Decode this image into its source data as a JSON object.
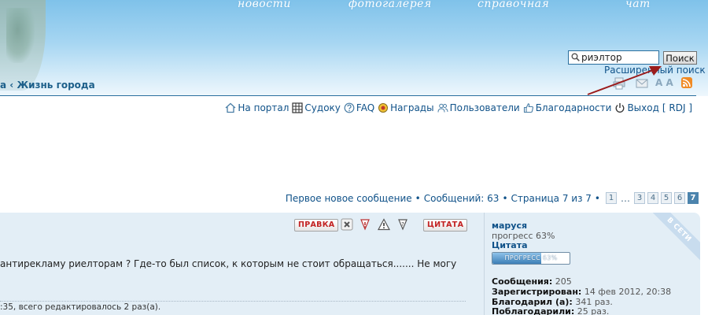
{
  "header": {
    "nav": [
      "новости",
      "фотогалерея",
      "справочная",
      "чат"
    ],
    "search": {
      "value": "риэлтор",
      "button_label": "Поиск",
      "advanced_link": "Расширенный поиск"
    },
    "breadcrumb": {
      "prev": "а",
      "separator": "‹",
      "current": "Жизнь города"
    },
    "tools": {
      "font_size": "A A"
    }
  },
  "navbar": {
    "items": [
      {
        "label": "На портал",
        "icon": "home-icon"
      },
      {
        "label": "Судоку",
        "icon": "grid-icon"
      },
      {
        "label": "FAQ",
        "icon": "help-icon"
      },
      {
        "label": "Награды",
        "icon": "medal-icon"
      },
      {
        "label": "Пользователи",
        "icon": "users-icon"
      },
      {
        "label": "Благодарности",
        "icon": "thumbs-up-icon"
      },
      {
        "label": "Выход",
        "icon": "power-icon"
      }
    ],
    "user": "[ RDJ ]"
  },
  "pagination": {
    "first_new": "Первое новое сообщение",
    "bullet": "•",
    "messages": "Сообщений: 63",
    "page_info": "Страница 7 из 7",
    "pages": [
      "1",
      "3",
      "4",
      "5",
      "6",
      "7"
    ],
    "dots": "…",
    "current": "7"
  },
  "post": {
    "buttons": {
      "edit": "ПРАВКА",
      "quote": "ЦИТАТА"
    },
    "text": "антирекламу риелторам ? Где-то был список, к которым не стоит обращаться....... Не могу",
    "edit_notice": ":35, всего редактировалось 2 раз(а).",
    "profile": {
      "username": "маруся",
      "rank": "прогресс 63%",
      "quote_link": "Цитата",
      "progress_label": "ПРОГРЕСС 63%",
      "progress_value": 0.63,
      "online": "В СЕТИ",
      "stats": [
        {
          "label": "Сообщения:",
          "value": "205"
        },
        {
          "label": "Зарегистрирован:",
          "value": "14 фев 2012, 20:38"
        },
        {
          "label": "Благодарил (а):",
          "value": "341 раз."
        },
        {
          "label": "Поблагодарили:",
          "value": "25 раз."
        }
      ]
    }
  },
  "colors": {
    "link": "#105289",
    "post_bg": "#e3eef6",
    "accent_red": "#c32323",
    "header_line": "#2a6f9e"
  }
}
